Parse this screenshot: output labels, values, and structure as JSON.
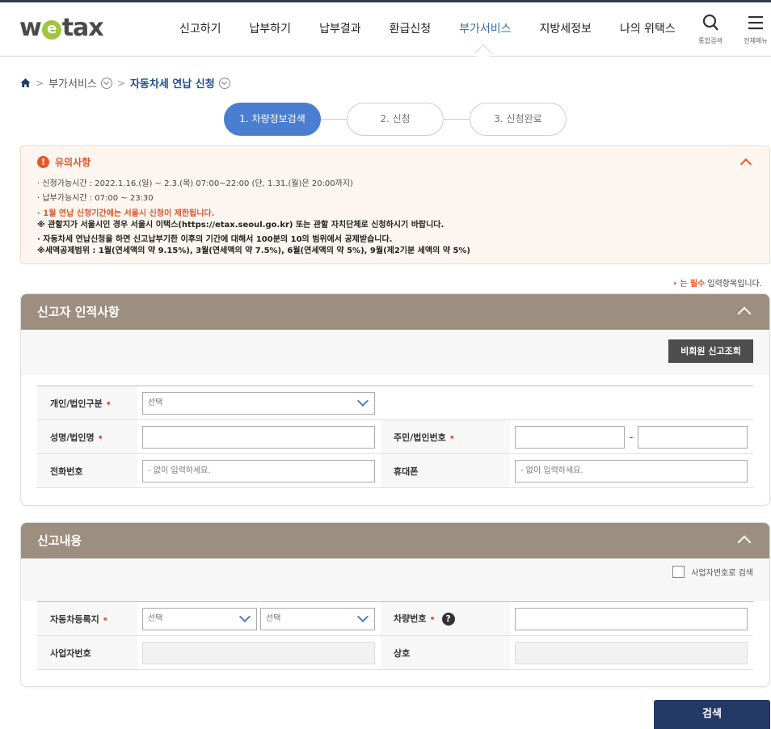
{
  "header": {
    "logo": {
      "pre": "w",
      "e": "e",
      "post": "tax"
    },
    "nav": [
      "신고하기",
      "납부하기",
      "납부결과",
      "환급신청",
      "부가서비스",
      "지방세정보",
      "나의 위택스"
    ],
    "active_nav": "부가서비스",
    "search_label": "통합검색",
    "menu_label": "전체메뉴"
  },
  "breadcrumb": {
    "level1": "부가서비스",
    "current": "자동차세 연납 신청"
  },
  "steps": [
    "1. 차량정보검색",
    "2. 신청",
    "3. 신청완료"
  ],
  "notice": {
    "title": "유의사항",
    "lines": [
      "· 신청가능시간 : 2022.1.16.(일) ~ 2.3.(목) 07:00~22:00 (단, 1.31.(월)은 20:00까지)",
      "· 납부가능시간 : 07:00 ~ 23:30",
      "· 1월 연납 신청기간에는 서울시 신청이 제한됩니다.",
      "※ 관할지가 서울시인 경우 서울시 이택스(https://etax.seoul.go.kr) 또는 관할 자치단체로 신청하시기 바랍니다.",
      "· 자동차세 연납신청을 하면 신고납부기한 이후의 기간에 대해서 100분의 10의 범위에서 공제받습니다.",
      "※세액공제범위 : 1월(연세액의 약 9.15%), 3월(연세액의 약 7.5%), 6월(연세액의 약 5%), 9월(제2기분 세액의 약 5%)"
    ]
  },
  "required_note": {
    "dot": "•",
    "pre": "는",
    "em": "필수",
    "post": "입력항목입니다."
  },
  "section1": {
    "title": "신고자 인적사항",
    "nonmember_button": "비회원 신고조회",
    "type_label": "개인/법인구분",
    "type_value": "선택",
    "name_label": "성명/법인명",
    "id_label": "주민/법인번호",
    "id_sep": "-",
    "phone_label": "전화번호",
    "phone_placeholder": "- 없이 입력하세요.",
    "mobile_label": "휴대폰",
    "mobile_placeholder": "- 없이 입력하세요."
  },
  "section2": {
    "title": "신고내용",
    "biz_search_label": "사업자번호로 검색",
    "region_label": "자동차등록지",
    "region_select1": "선택",
    "region_select2": "선택",
    "plate_label": "차량번호",
    "biz_no_label": "사업자번호",
    "company_label": "상호"
  },
  "search_button": "검색",
  "colors": {
    "accent": "#4a7ed0",
    "panel_head": "#9c8f7f",
    "warning": "#e8572a",
    "search_button": "#243a66"
  }
}
